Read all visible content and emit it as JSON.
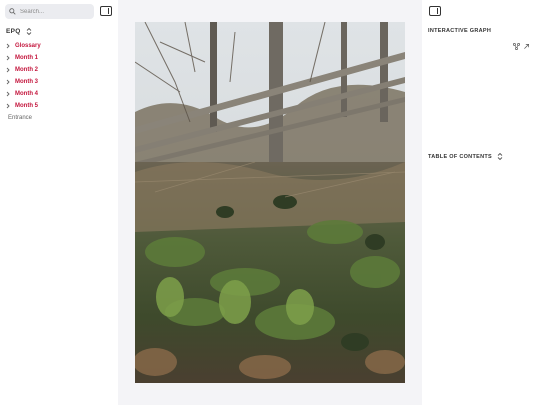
{
  "sidebar": {
    "search_placeholder": "Search...",
    "vault_name": "EPQ",
    "items": [
      {
        "label": "Glossary",
        "kind": "folder"
      },
      {
        "label": "Month 1",
        "kind": "folder"
      },
      {
        "label": "Month 2",
        "kind": "folder"
      },
      {
        "label": "Month 3",
        "kind": "folder"
      },
      {
        "label": "Month 4",
        "kind": "folder"
      },
      {
        "label": "Month 5",
        "kind": "folder"
      },
      {
        "label": "Entrance",
        "kind": "file"
      }
    ]
  },
  "right_panel": {
    "graph_title": "INTERACTIVE GRAPH",
    "toc_title": "TABLE OF CONTENTS"
  },
  "colors": {
    "folder_text": "#c4163d",
    "main_background": "#f4f4f7",
    "search_background": "#ebecf0"
  },
  "icons": [
    "search-icon",
    "panel-toggle-icon",
    "chevron-updown-icon",
    "chevron-right-icon",
    "graph-icon",
    "expand-icon"
  ]
}
